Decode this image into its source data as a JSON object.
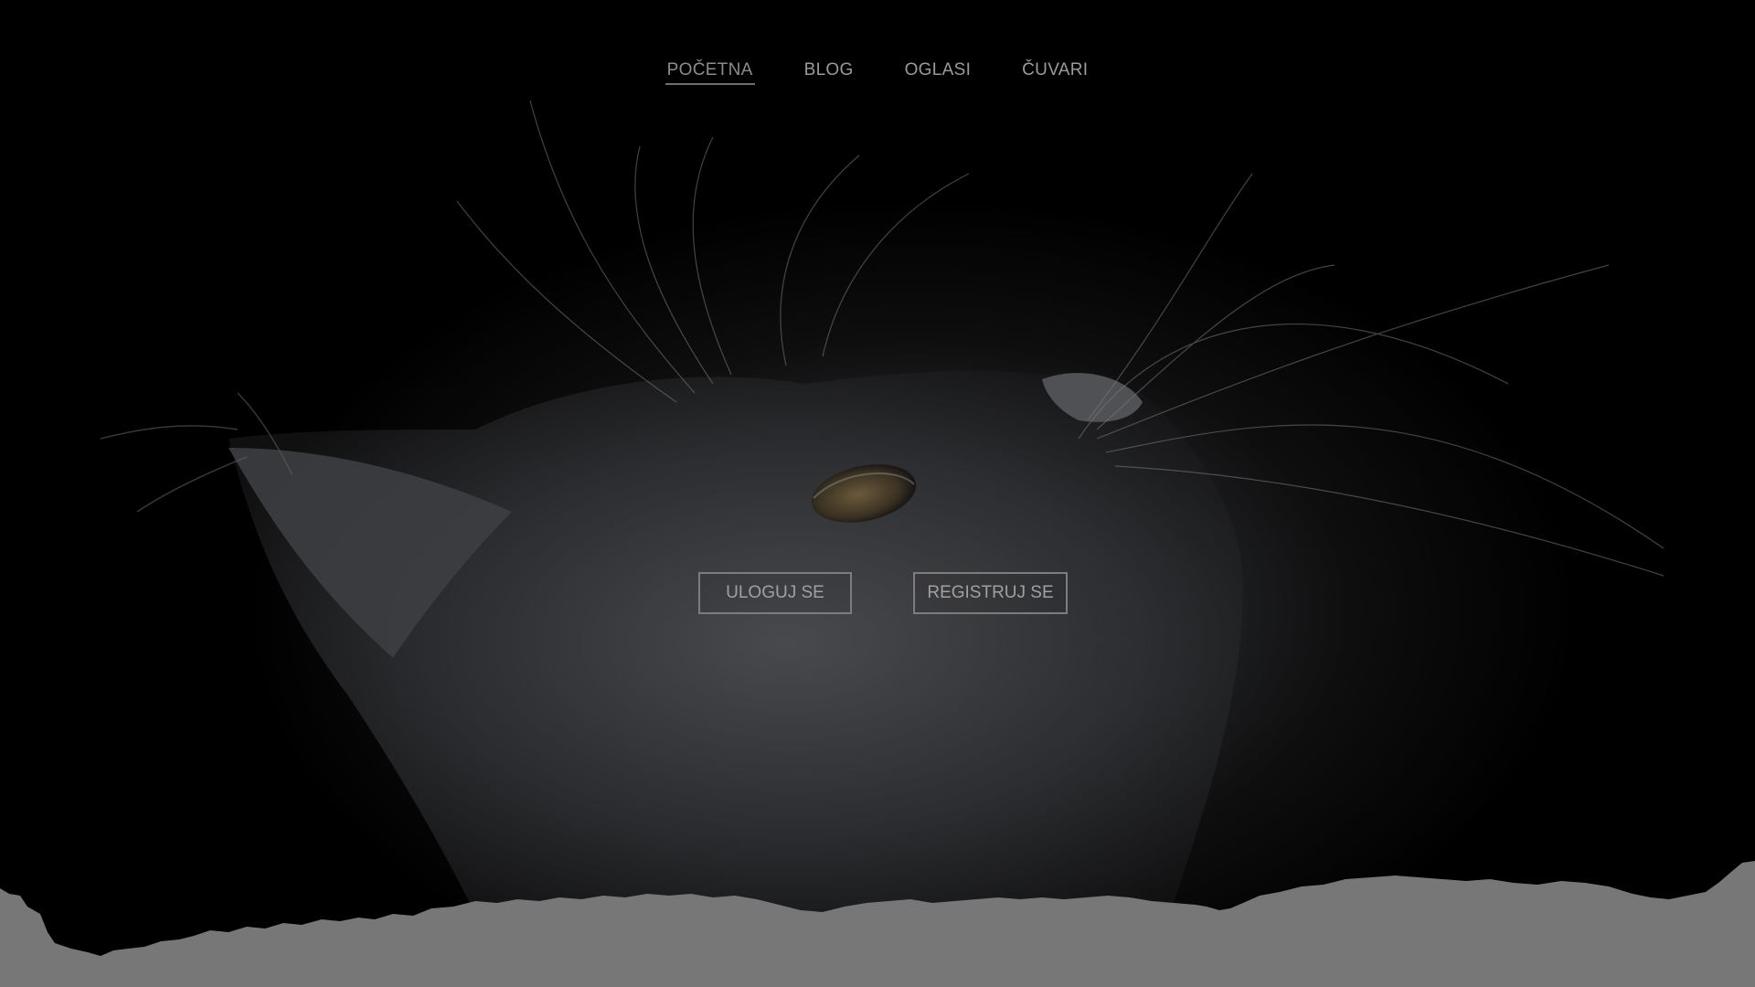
{
  "nav": {
    "items": [
      {
        "label": "POČETNA",
        "active": true
      },
      {
        "label": "BLOG",
        "active": false
      },
      {
        "label": "OGLASI",
        "active": false
      },
      {
        "label": "ČUVARI",
        "active": false
      }
    ]
  },
  "hero": {
    "login_label": "ULOGUJ SE",
    "register_label": "REGISTRUJ SE",
    "background_image": "grey-kitten-looking-up-photo"
  },
  "colors": {
    "background": "#000000",
    "footer": "#777777",
    "nav_text": "#9a9a9a",
    "button_border": "#7d7d7d"
  }
}
